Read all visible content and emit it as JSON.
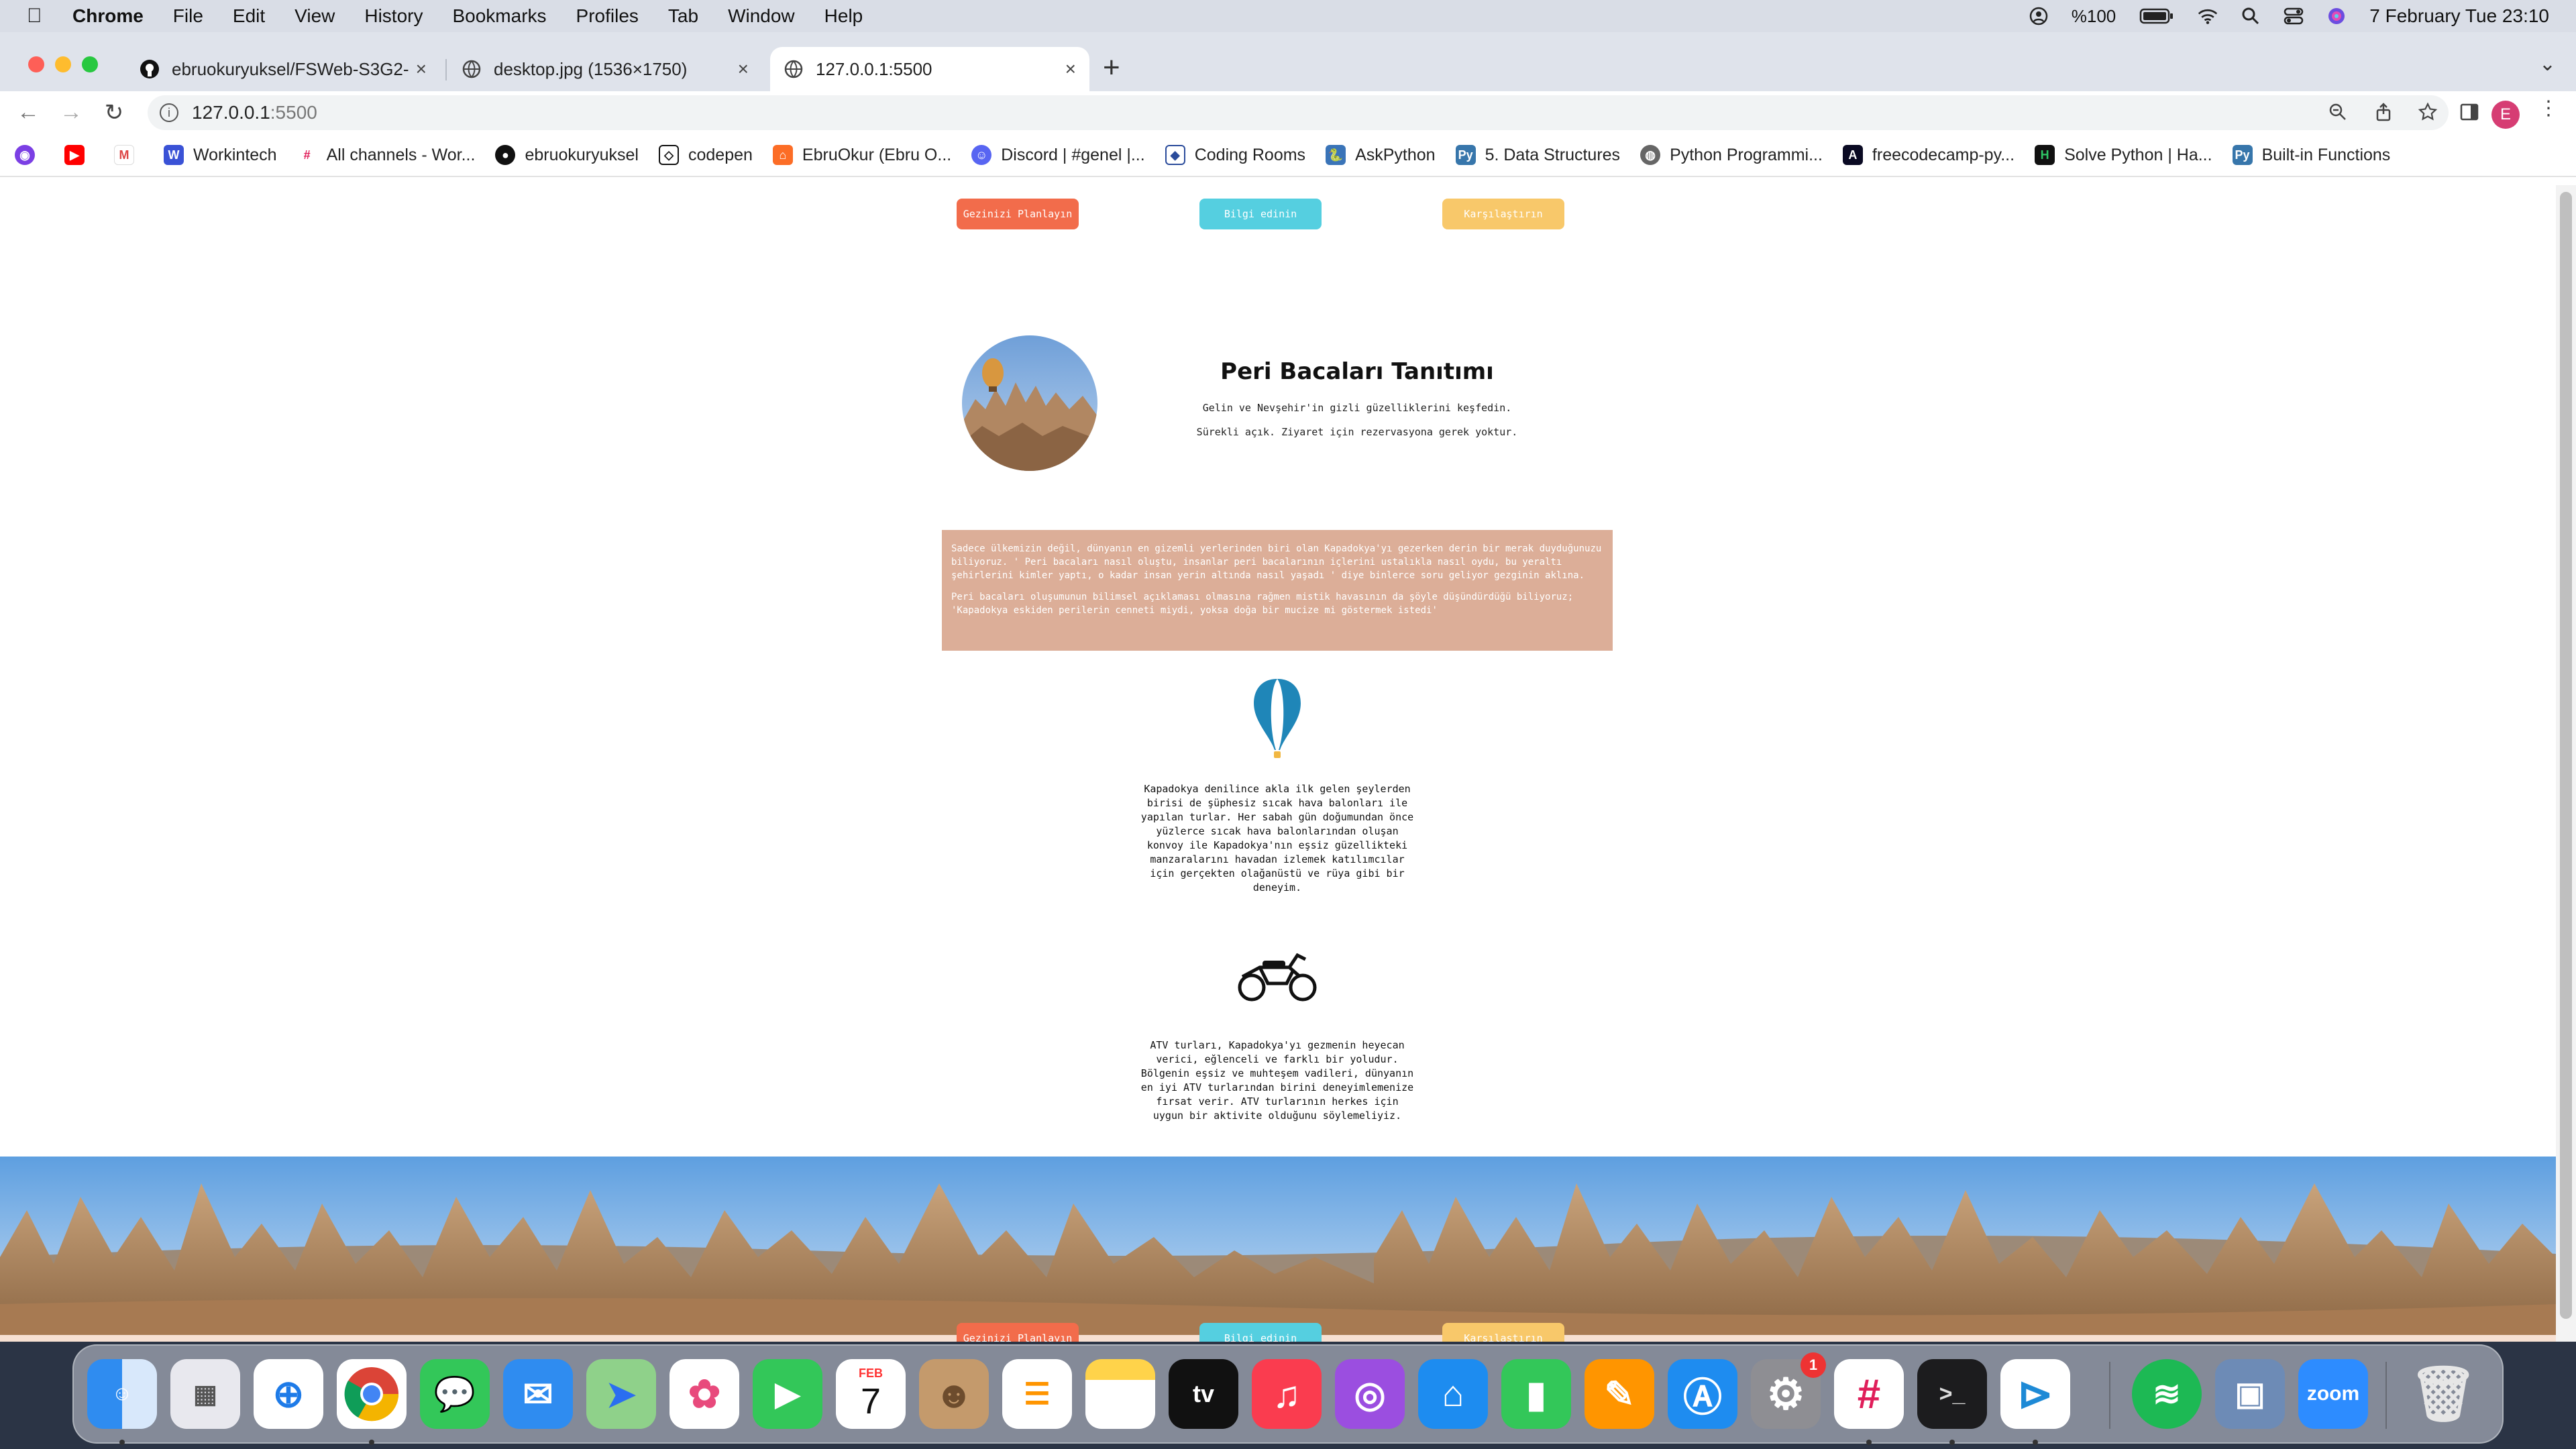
{
  "menubar": {
    "items": [
      "Chrome",
      "File",
      "Edit",
      "View",
      "History",
      "Bookmarks",
      "Profiles",
      "Tab",
      "Window",
      "Help"
    ],
    "battery": "%100",
    "datetime": "7 February Tue  23:10"
  },
  "tabs": [
    {
      "label": "ebruokuryuksel/FSWeb-S3G2-",
      "icon": "github-icon"
    },
    {
      "label": "desktop.jpg (1536×1750)",
      "icon": "globe-icon"
    },
    {
      "label": "127.0.0.1:5500",
      "icon": "globe-icon",
      "active": true
    }
  ],
  "address": {
    "host": "127.0.0.1",
    "port": ":5500"
  },
  "profile_initial": "E",
  "bookmarks": [
    {
      "label": "",
      "icon": "bookmark-purple-icon"
    },
    {
      "label": "",
      "icon": "youtube-icon"
    },
    {
      "label": "",
      "icon": "gmail-icon"
    },
    {
      "label": "Workintech",
      "icon": "workintech-icon"
    },
    {
      "label": "All channels - Wor...",
      "icon": "slack-icon"
    },
    {
      "label": "ebruokuryuksel",
      "icon": "github-icon"
    },
    {
      "label": "codepen",
      "icon": "codepen-icon"
    },
    {
      "label": "EbruOkur (Ebru O...",
      "icon": "gitlab-icon"
    },
    {
      "label": "Discord | #genel |...",
      "icon": "discord-icon"
    },
    {
      "label": "Coding Rooms",
      "icon": "codingrooms-icon"
    },
    {
      "label": "AskPython",
      "icon": "askpython-icon"
    },
    {
      "label": "5. Data Structures",
      "icon": "python-icon"
    },
    {
      "label": "Python Programmi...",
      "icon": "globe-icon"
    },
    {
      "label": "freecodecamp-py...",
      "icon": "freecodecamp-icon"
    },
    {
      "label": "Solve Python | Ha...",
      "icon": "hackerrank-icon"
    },
    {
      "label": "Built-in Functions",
      "icon": "python-icon"
    }
  ],
  "page": {
    "nav_buttons": {
      "plan": "Gezinizi Planlayın",
      "info": "Bilgi edinin",
      "compare": "Karşılaştırın"
    },
    "hero": {
      "title": "Peri Bacaları Tanıtımı",
      "subtitle": "Gelin ve Nevşehir'in gizli güzelliklerini keşfedin.",
      "note": "Sürekli açık. Ziyaret için rezervasyona gerek yoktur."
    },
    "intro": {
      "p1": "Sadece ülkemizin değil, dünyanın en gizemli yerlerinden biri olan Kapadokya'yı gezerken derin bir merak duyduğunuzu biliyoruz. ' Peri bacaları nasıl oluştu, insanlar peri bacalarının içlerini ustalıkla nasıl oydu, bu yeraltı şehirlerini kimler yaptı, o kadar insan yerin altında nasıl yaşadı ' diye binlerce soru geliyor gezginin aklına.",
      "p2": "Peri bacaları oluşumunun bilimsel açıklaması olmasına rağmen mistik havasının da şöyle düşündürdüğü biliyoruz; 'Kapadokya eskiden perilerin cenneti miydi, yoksa doğa bir mucize mi göstermek istedi'"
    },
    "balloon_text": "Kapadokya denilince akla ilk gelen şeylerden birisi de şüphesiz sıcak hava balonları ile yapılan turlar. Her sabah gün doğumundan önce yüzlerce sıcak hava balonlarından oluşan konvoy ile Kapadokya'nın eşsiz güzellikteki manzaralarını havadan izlemek katılımcılar için gerçekten olağanüstü ve rüya gibi bir deneyim.",
    "atv_text": "ATV turları, Kapadokya'yı gezmenin heyecan verici, eğlenceli ve farklı bir yoludur. Bölgenin eşsiz ve muhteşem vadileri, dünyanın en iyi ATV turlarından birini deneyimlemenize fırsat verir. ATV turlarının herkes için uygun bir aktivite olduğunu söylemeliyiz.",
    "footer_buttons": {
      "plan": "Gezinizi Planlayın",
      "info": "Bilgi edinin",
      "compare": "Karşılaştırın"
    }
  },
  "dock": {
    "apps": [
      "Finder",
      "Launchpad",
      "Safari",
      "Chrome",
      "Messages",
      "Mail",
      "Maps",
      "Photos",
      "FaceTime",
      "Calendar",
      "Contacts",
      "Reminders",
      "Notes",
      "TV",
      "Music",
      "Podcasts",
      "Keynote",
      "Numbers",
      "Pages",
      "App Store",
      "System Settings",
      "Slack",
      "Terminal",
      "VS Code",
      "Spotify",
      "Preview",
      "Zoom",
      "Trash"
    ],
    "calendar_month": "FEB",
    "calendar_day": "7",
    "tv_label": "tv",
    "zoom_label": "zoom",
    "settings_badge": "1"
  }
}
